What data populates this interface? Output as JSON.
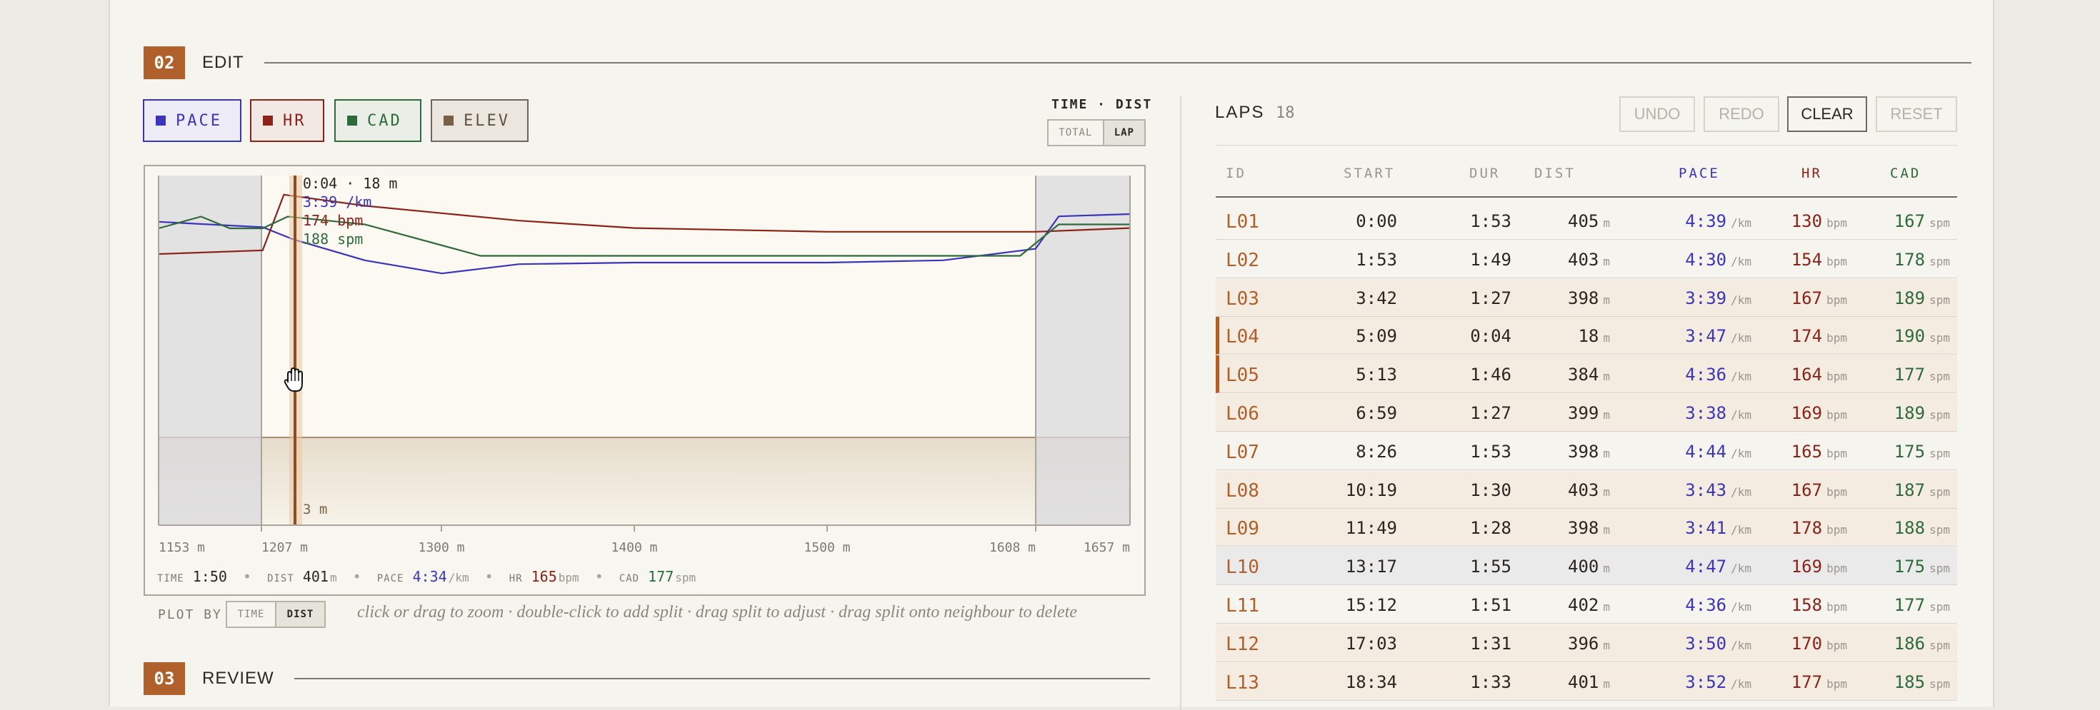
{
  "colors": {
    "accent": "#b0602a",
    "pace": "#3b35b7",
    "hr": "#8a2418",
    "cad": "#2e6a3c",
    "elev": "#7a6046"
  },
  "section_edit": {
    "num": "02",
    "title": "EDIT"
  },
  "section_review": {
    "num": "03",
    "title": "REVIEW"
  },
  "metrics": [
    {
      "label": "PACE",
      "icon": "pace-swatch-icon"
    },
    {
      "label": "HR",
      "icon": "hr-swatch-icon"
    },
    {
      "label": "CAD",
      "icon": "cad-swatch-icon"
    },
    {
      "label": "ELEV",
      "icon": "elev-swatch-icon"
    }
  ],
  "view_toggle": {
    "title": "TIME · DIST",
    "options": [
      "TOTAL",
      "LAP"
    ],
    "selected": "LAP"
  },
  "chart": {
    "tooltip": {
      "time_dist": "0:04 · 18 m",
      "pace": "3:39 /km",
      "hr": "174 bpm",
      "cad": "188 spm"
    },
    "elev_label": "3 m",
    "x_ticks": [
      "1153 m",
      "1207 m",
      "1300 m",
      "1400 m",
      "1500 m",
      "1608 m",
      "1657 m"
    ],
    "cursor_icon": "hand-grab-icon"
  },
  "chart_data": {
    "type": "line",
    "x_range_m": [
      1153,
      1657
    ],
    "selection_m": [
      1207,
      1608
    ],
    "series": [
      {
        "name": "PACE",
        "points": [
          [
            1153,
            3.55
          ],
          [
            1207,
            3.62
          ],
          [
            1223,
            3.78
          ],
          [
            1260,
            4.05
          ],
          [
            1300,
            4.22
          ],
          [
            1340,
            4.1
          ],
          [
            1400,
            4.08
          ],
          [
            1500,
            4.08
          ],
          [
            1560,
            4.05
          ],
          [
            1608,
            3.9
          ],
          [
            1620,
            3.48
          ],
          [
            1657,
            3.45
          ]
        ]
      },
      {
        "name": "HR",
        "points": [
          [
            1153,
            158
          ],
          [
            1207,
            159
          ],
          [
            1218,
            174
          ],
          [
            1260,
            171
          ],
          [
            1300,
            169
          ],
          [
            1340,
            167
          ],
          [
            1400,
            165
          ],
          [
            1500,
            164
          ],
          [
            1608,
            164
          ],
          [
            1657,
            165
          ]
        ]
      },
      {
        "name": "CAD",
        "points": [
          [
            1153,
            185
          ],
          [
            1175,
            188
          ],
          [
            1190,
            185
          ],
          [
            1207,
            185
          ],
          [
            1220,
            188
          ],
          [
            1260,
            186
          ],
          [
            1320,
            178
          ],
          [
            1400,
            178
          ],
          [
            1500,
            178
          ],
          [
            1600,
            178
          ],
          [
            1620,
            186
          ],
          [
            1657,
            186
          ]
        ]
      }
    ]
  },
  "stats": {
    "time_label": "TIME",
    "time": "1:50",
    "dist_label": "DIST",
    "dist": "401",
    "dist_unit": "m",
    "pace_label": "PACE",
    "pace": "4:34",
    "pace_unit": "/km",
    "hr_label": "HR",
    "hr": "165",
    "hr_unit": "bpm",
    "cad_label": "CAD",
    "cad": "177",
    "cad_unit": "spm",
    "sep": "•"
  },
  "plot_by": {
    "label": "PLOT BY",
    "options": [
      "TIME",
      "DIST"
    ],
    "selected": "DIST"
  },
  "hint": "click or drag to zoom · double-click to add split · drag split to adjust · drag split onto neighbour to delete",
  "laps": {
    "title": "LAPS",
    "count": "18",
    "buttons": [
      "UNDO",
      "REDO",
      "CLEAR",
      "RESET"
    ],
    "columns": [
      "ID",
      "START",
      "DUR",
      "DIST",
      "PACE",
      "HR",
      "CAD"
    ],
    "units": {
      "dist": "m",
      "pace": "/km",
      "hr": "bpm",
      "cad": "spm"
    },
    "rows": [
      {
        "id": "L01",
        "start": "0:00",
        "dur": "1:53",
        "dist": "405",
        "pace": "4:39",
        "hr": "130",
        "cad": "167"
      },
      {
        "id": "L02",
        "start": "1:53",
        "dur": "1:49",
        "dist": "403",
        "pace": "4:30",
        "hr": "154",
        "cad": "178"
      },
      {
        "id": "L03",
        "start": "3:42",
        "dur": "1:27",
        "dist": "398",
        "pace": "3:39",
        "hr": "167",
        "cad": "189"
      },
      {
        "id": "L04",
        "start": "5:09",
        "dur": "0:04",
        "dist": "18",
        "pace": "3:47",
        "hr": "174",
        "cad": "190"
      },
      {
        "id": "L05",
        "start": "5:13",
        "dur": "1:46",
        "dist": "384",
        "pace": "4:36",
        "hr": "164",
        "cad": "177"
      },
      {
        "id": "L06",
        "start": "6:59",
        "dur": "1:27",
        "dist": "399",
        "pace": "3:38",
        "hr": "169",
        "cad": "189"
      },
      {
        "id": "L07",
        "start": "8:26",
        "dur": "1:53",
        "dist": "398",
        "pace": "4:44",
        "hr": "165",
        "cad": "175"
      },
      {
        "id": "L08",
        "start": "10:19",
        "dur": "1:30",
        "dist": "403",
        "pace": "3:43",
        "hr": "167",
        "cad": "187"
      },
      {
        "id": "L09",
        "start": "11:49",
        "dur": "1:28",
        "dist": "398",
        "pace": "3:41",
        "hr": "178",
        "cad": "188"
      },
      {
        "id": "L10",
        "start": "13:17",
        "dur": "1:55",
        "dist": "400",
        "pace": "4:47",
        "hr": "169",
        "cad": "175"
      },
      {
        "id": "L11",
        "start": "15:12",
        "dur": "1:51",
        "dist": "402",
        "pace": "4:36",
        "hr": "158",
        "cad": "177"
      },
      {
        "id": "L12",
        "start": "17:03",
        "dur": "1:31",
        "dist": "396",
        "pace": "3:50",
        "hr": "170",
        "cad": "186"
      },
      {
        "id": "L13",
        "start": "18:34",
        "dur": "1:33",
        "dist": "401",
        "pace": "3:52",
        "hr": "177",
        "cad": "185"
      }
    ]
  }
}
